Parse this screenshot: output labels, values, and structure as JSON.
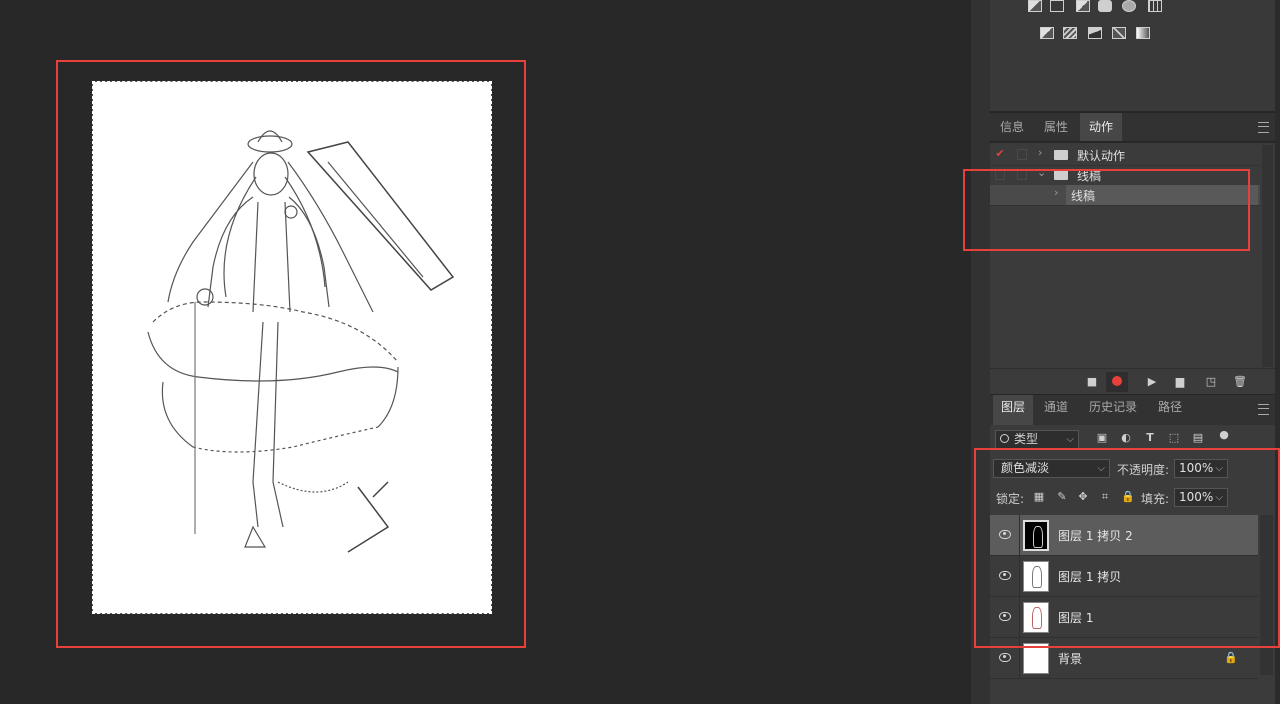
{
  "adjustments_panel": {
    "icons": [
      "levels-icon",
      "balance-icon",
      "black-white-icon",
      "photo-filter-icon",
      "channel-mixer-icon",
      "color-lookup-icon",
      "invert-icon",
      "posterize-icon",
      "threshold-icon",
      "selective-color-icon",
      "gradient-map-icon"
    ]
  },
  "info_tabs": {
    "tabs": [
      {
        "label": "信息",
        "active": false
      },
      {
        "label": "属性",
        "active": false
      },
      {
        "label": "动作",
        "active": true
      }
    ]
  },
  "actions": {
    "rows": [
      {
        "label": "默认动作",
        "checked": true,
        "expanded": false,
        "kind": "set"
      },
      {
        "label": "线稿",
        "checked": false,
        "expanded": true,
        "kind": "set"
      },
      {
        "label": "线稿",
        "checked": false,
        "expanded": false,
        "kind": "action",
        "selected": true
      }
    ],
    "footer_icons": [
      "stop-icon",
      "record-icon",
      "play-icon",
      "new-set-icon",
      "new-action-icon",
      "delete-icon"
    ],
    "record_color": "#e8403a"
  },
  "layers_tabs": {
    "tabs": [
      {
        "label": "图层",
        "active": true
      },
      {
        "label": "通道",
        "active": false
      },
      {
        "label": "历史记录",
        "active": false
      },
      {
        "label": "路径",
        "active": false
      }
    ]
  },
  "layers": {
    "filter_label": "类型",
    "blend_mode": "颜色减淡",
    "opacity_label": "不透明度:",
    "opacity_value": "100%",
    "lock_label": "锁定:",
    "fill_label": "填充:",
    "fill_value": "100%",
    "list": [
      {
        "name": "图层 1 拷贝 2",
        "visible": true,
        "selected": true,
        "thumb": "dark"
      },
      {
        "name": "图层 1 拷贝",
        "visible": true,
        "selected": false,
        "thumb": "sketch"
      },
      {
        "name": "图层 1",
        "visible": true,
        "selected": false,
        "thumb": "sketch-red"
      },
      {
        "name": "背景",
        "visible": true,
        "selected": false,
        "thumb": "white",
        "locked": true
      }
    ]
  },
  "highlight_color": "#e8403a"
}
